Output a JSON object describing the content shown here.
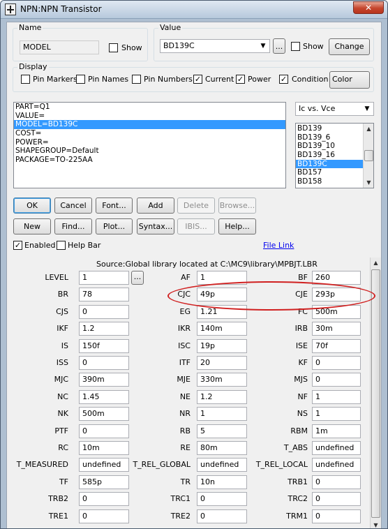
{
  "window": {
    "title": "NPN:NPN Transistor",
    "close_glyph": "✕"
  },
  "name_group": {
    "label": "Name",
    "value": "MODEL",
    "show_label": "Show",
    "show_checked": false
  },
  "value_group": {
    "label": "Value",
    "value": "BD139C",
    "browse_label": "...",
    "show_label": "Show",
    "show_checked": false,
    "change_label": "Change"
  },
  "display": {
    "label": "Display",
    "options": [
      {
        "label": "Pin Markers",
        "checked": false
      },
      {
        "label": "Pin Names",
        "checked": false
      },
      {
        "label": "Pin Numbers",
        "checked": false
      },
      {
        "label": "Current",
        "checked": true
      },
      {
        "label": "Power",
        "checked": true
      },
      {
        "label": "Condition",
        "checked": true
      }
    ],
    "color_label": "Color"
  },
  "attributes": {
    "rows": [
      "PART=Q1",
      "VALUE=",
      "MODEL=BD139C",
      "COST=",
      "POWER=",
      "SHAPEGROUP=Default",
      "PACKAGE=TO-225AA"
    ],
    "selected_index": 2
  },
  "curve_select": {
    "value": "Ic vs. Vce"
  },
  "model_list": {
    "items": [
      "BD139",
      "BD139_6",
      "BD139_10",
      "BD139_16",
      "BD139C",
      "BD157",
      "BD158"
    ],
    "selected_index": 4
  },
  "buttons_row1": [
    {
      "label": "OK",
      "enabled": true,
      "default": true
    },
    {
      "label": "Cancel",
      "enabled": true
    },
    {
      "label": "Font...",
      "enabled": true
    },
    {
      "label": "Add",
      "enabled": true
    },
    {
      "label": "Delete",
      "enabled": false
    },
    {
      "label": "Browse...",
      "enabled": false
    }
  ],
  "buttons_row2": [
    {
      "label": "New",
      "enabled": true
    },
    {
      "label": "Find...",
      "enabled": true
    },
    {
      "label": "Plot...",
      "enabled": true
    },
    {
      "label": "Syntax...",
      "enabled": true
    },
    {
      "label": "IBIS...",
      "enabled": false
    },
    {
      "label": "Help...",
      "enabled": true
    }
  ],
  "options": {
    "enabled_label": "Enabled",
    "enabled_checked": true,
    "helpbar_label": "Help Bar",
    "helpbar_checked": false,
    "file_link": "File Link"
  },
  "source": "Source:Global library located at C:\\MC9\\library\\MPBJT.LBR",
  "level_browse_label": "...",
  "params": [
    [
      {
        "name": "LEVEL",
        "value": "1"
      },
      {
        "name": "AF",
        "value": "1"
      },
      {
        "name": "BF",
        "value": "260"
      }
    ],
    [
      {
        "name": "BR",
        "value": "78"
      },
      {
        "name": "CJC",
        "value": "49p"
      },
      {
        "name": "CJE",
        "value": "293p"
      }
    ],
    [
      {
        "name": "CJS",
        "value": "0"
      },
      {
        "name": "EG",
        "value": "1.21"
      },
      {
        "name": "FC",
        "value": "500m"
      }
    ],
    [
      {
        "name": "IKF",
        "value": "1.2"
      },
      {
        "name": "IKR",
        "value": "140m"
      },
      {
        "name": "IRB",
        "value": "30m"
      }
    ],
    [
      {
        "name": "IS",
        "value": "150f"
      },
      {
        "name": "ISC",
        "value": "19p"
      },
      {
        "name": "ISE",
        "value": "70f"
      }
    ],
    [
      {
        "name": "ISS",
        "value": "0"
      },
      {
        "name": "ITF",
        "value": "20"
      },
      {
        "name": "KF",
        "value": "0"
      }
    ],
    [
      {
        "name": "MJC",
        "value": "390m"
      },
      {
        "name": "MJE",
        "value": "330m"
      },
      {
        "name": "MJS",
        "value": "0"
      }
    ],
    [
      {
        "name": "NC",
        "value": "1.45"
      },
      {
        "name": "NE",
        "value": "1.2"
      },
      {
        "name": "NF",
        "value": "1"
      }
    ],
    [
      {
        "name": "NK",
        "value": "500m"
      },
      {
        "name": "NR",
        "value": "1"
      },
      {
        "name": "NS",
        "value": "1"
      }
    ],
    [
      {
        "name": "PTF",
        "value": "0"
      },
      {
        "name": "RB",
        "value": "5"
      },
      {
        "name": "RBM",
        "value": "1m"
      }
    ],
    [
      {
        "name": "RC",
        "value": "10m"
      },
      {
        "name": "RE",
        "value": "80m"
      },
      {
        "name": "T_ABS",
        "value": "undefined"
      }
    ],
    [
      {
        "name": "T_MEASURED",
        "value": "undefined"
      },
      {
        "name": "T_REL_GLOBAL",
        "value": "undefined"
      },
      {
        "name": "T_REL_LOCAL",
        "value": "undefined"
      }
    ],
    [
      {
        "name": "TF",
        "value": "585p"
      },
      {
        "name": "TR",
        "value": "10n"
      },
      {
        "name": "TRB1",
        "value": "0"
      }
    ],
    [
      {
        "name": "TRB2",
        "value": "0"
      },
      {
        "name": "TRC1",
        "value": "0"
      },
      {
        "name": "TRC2",
        "value": "0"
      }
    ],
    [
      {
        "name": "TRE1",
        "value": "0"
      },
      {
        "name": "TRE2",
        "value": "0"
      },
      {
        "name": "TRM1",
        "value": "0"
      }
    ]
  ],
  "highlight": {
    "color": "#d02020"
  }
}
